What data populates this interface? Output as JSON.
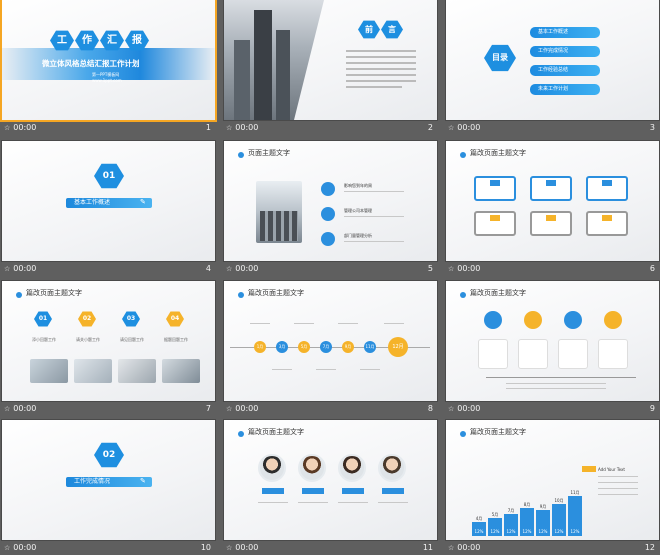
{
  "slides": [
    {
      "num": "1",
      "time": "00:00",
      "title_chars": [
        "工",
        "作",
        "汇",
        "报"
      ],
      "subtitle": "微立体风格总结汇报工作计划",
      "meta1": "第一PPT模板网",
      "meta2": "www.1ppt.com"
    },
    {
      "num": "2",
      "time": "00:00",
      "title_chars": [
        "前",
        "言"
      ]
    },
    {
      "num": "3",
      "time": "00:00",
      "title": "目录",
      "items": [
        "基本工作概述",
        "工作完成情况",
        "工作经验总结",
        "未来工作计划"
      ]
    },
    {
      "num": "4",
      "time": "00:00",
      "index": "01",
      "title": "基本工作概述"
    },
    {
      "num": "5",
      "time": "00:00",
      "header": "页面主题文字",
      "items": [
        "影响您到年的周",
        "管理公司本管理",
        "部门量管理分析"
      ]
    },
    {
      "num": "6",
      "time": "00:00",
      "header": "篇改页面主题文字"
    },
    {
      "num": "7",
      "time": "00:00",
      "header": "篇改页面主题文字",
      "indices": [
        "01",
        "02",
        "03",
        "04"
      ],
      "captions": [
        "添小回题工作",
        "请关小题工作",
        "请见回题工作",
        "据题回题工作"
      ]
    },
    {
      "num": "8",
      "time": "00:00",
      "header": "篇改页面主题文字",
      "months": [
        "1月",
        "3月",
        "5月",
        "7月",
        "9月",
        "11月",
        "12月"
      ]
    },
    {
      "num": "9",
      "time": "00:00",
      "header": "篇改页面主题文字"
    },
    {
      "num": "10",
      "time": "00:00",
      "index": "02",
      "title": "工作完成情况"
    },
    {
      "num": "11",
      "time": "00:00",
      "header": "篇改页面主题文字"
    },
    {
      "num": "12",
      "time": "00:00",
      "header": "篇改页面主题文字",
      "legend": "Add Your Text"
    }
  ],
  "chart_data": {
    "type": "bar",
    "categories": [
      "4月",
      "5月",
      "7月",
      "8月",
      "9月",
      "10月",
      "11月"
    ],
    "values": [
      12,
      12,
      12,
      12,
      12,
      12,
      12
    ],
    "title": "",
    "xlabel": "",
    "ylabel": ""
  },
  "colors": {
    "accent": "#1e8fe0",
    "accent_light": "#4ab3f0",
    "highlight": "#f5b32a",
    "background": "#5f5f5f"
  }
}
